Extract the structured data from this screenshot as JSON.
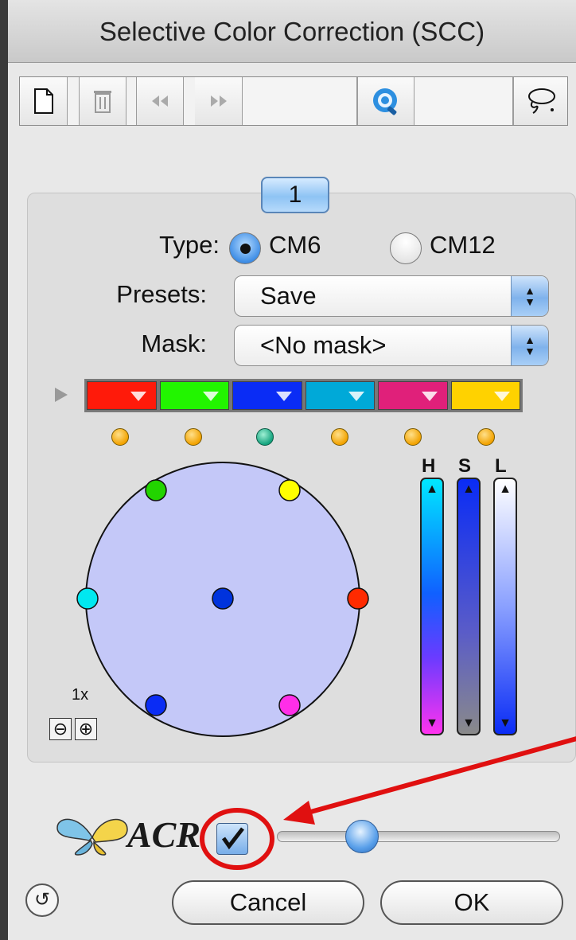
{
  "window": {
    "title": "Selective Color Correction (SCC)"
  },
  "toolbar": {
    "new_icon": "new-document-icon",
    "trash_icon": "trash-icon",
    "rewind_icon": "rewind-icon",
    "forward_icon": "fast-forward-icon",
    "preview_icon": "preview-magnifier-icon",
    "lasso_icon": "lasso-icon"
  },
  "tab": {
    "label": "1"
  },
  "type": {
    "label": "Type:",
    "options": [
      {
        "label": "CM6",
        "selected": true
      },
      {
        "label": "CM12",
        "selected": false
      }
    ]
  },
  "presets": {
    "label": "Presets:",
    "value": "Save"
  },
  "mask": {
    "label": "Mask:",
    "value": "<No mask>"
  },
  "swatches": [
    {
      "name": "red",
      "color": "#ff1a0a"
    },
    {
      "name": "green",
      "color": "#22f500"
    },
    {
      "name": "blue",
      "color": "#0a2cf5"
    },
    {
      "name": "cyan",
      "color": "#00a9d8"
    },
    {
      "name": "magenta",
      "color": "#e0207a"
    },
    {
      "name": "yellow",
      "color": "#ffd200"
    }
  ],
  "hsl": {
    "h_label": "H",
    "s_label": "S",
    "l_label": "L"
  },
  "zoom": {
    "label": "1x"
  },
  "acr": {
    "label": "ACR",
    "checked": true,
    "slider_value": 0.3
  },
  "buttons": {
    "cancel": "Cancel",
    "ok": "OK"
  },
  "colors": {
    "accent": "#4a90e2",
    "wheel": "#c4c8f8",
    "highlight": "#e01010"
  }
}
